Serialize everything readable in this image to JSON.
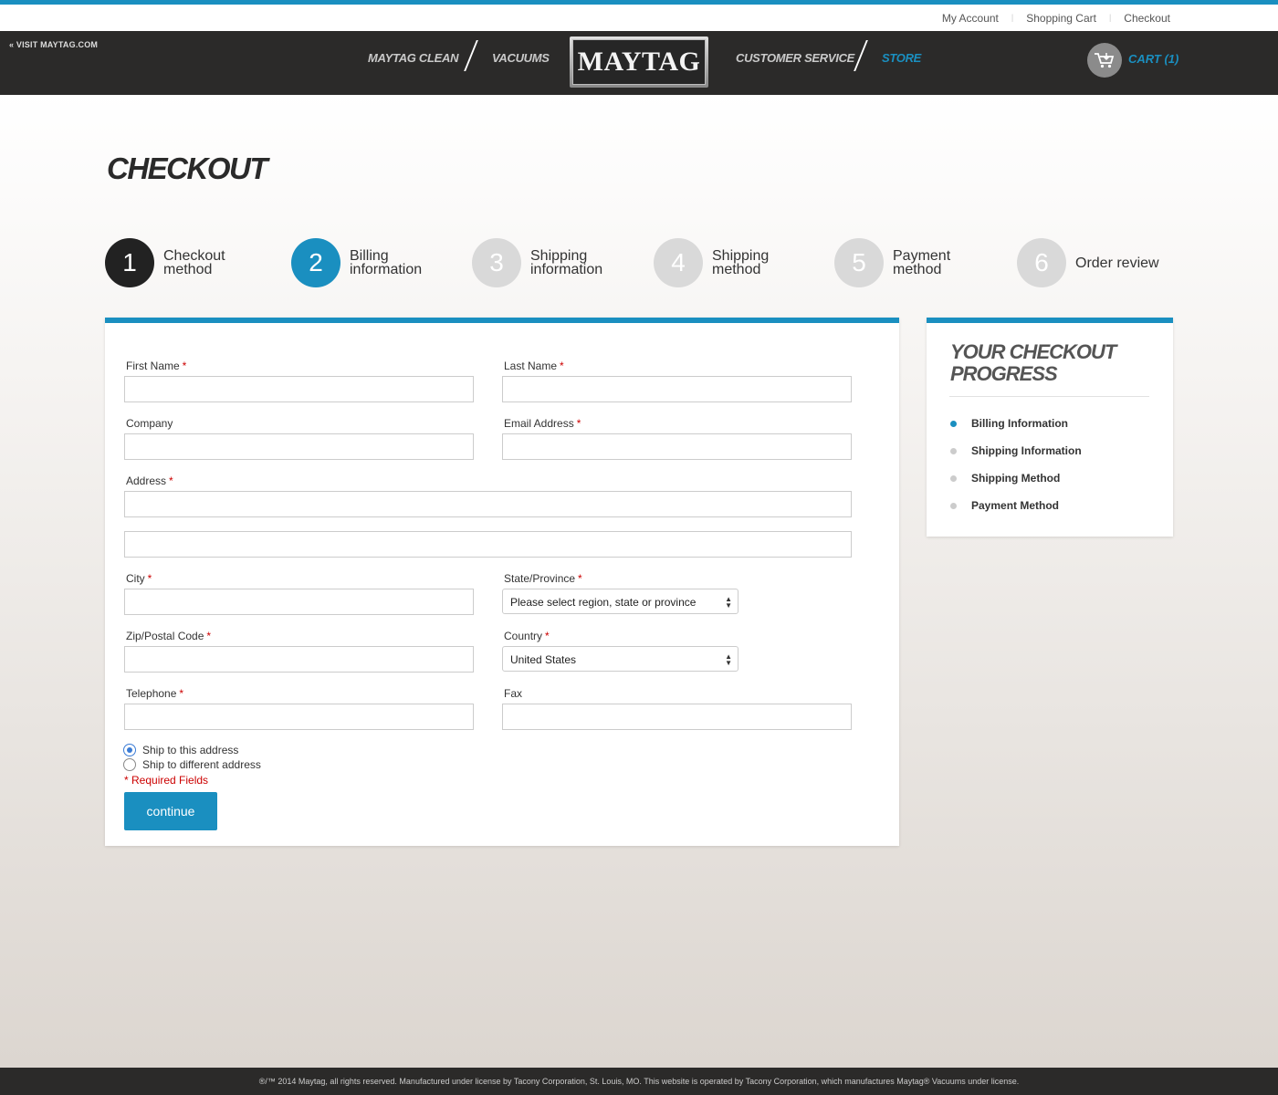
{
  "utility_links": [
    "My Account",
    "Shopping Cart",
    "Checkout"
  ],
  "nav": {
    "visit": "« VISIT MAYTAG.COM",
    "items": [
      "MAYTAG CLEAN",
      "VACUUMS",
      "CUSTOMER SERVICE",
      "STORE"
    ],
    "logo": "MAYTAG",
    "cart": "CART (1)"
  },
  "page_title": "CHECKOUT",
  "steps": [
    {
      "num": "1",
      "label": "Checkout method",
      "state": "done"
    },
    {
      "num": "2",
      "label": "Billing information",
      "state": "active"
    },
    {
      "num": "3",
      "label": "Shipping information",
      "state": "pending"
    },
    {
      "num": "4",
      "label": "Shipping method",
      "state": "pending"
    },
    {
      "num": "5",
      "label": "Payment method",
      "state": "pending"
    },
    {
      "num": "6",
      "label": "Order review",
      "state": "pending"
    }
  ],
  "form": {
    "first_name": "First Name",
    "last_name": "Last Name",
    "company": "Company",
    "email": "Email Address",
    "address": "Address",
    "city": "City",
    "state": "State/Province",
    "state_value": "Please select region, state or province",
    "zip": "Zip/Postal Code",
    "country": "Country",
    "country_value": "United States",
    "telephone": "Telephone",
    "fax": "Fax",
    "required_mark": "*",
    "ship_same": "Ship to this address",
    "ship_diff": "Ship to different address",
    "required_note": "* Required Fields",
    "continue": "continue"
  },
  "progress": {
    "title": "YOUR CHECKOUT PROGRESS",
    "items": [
      "Billing Information",
      "Shipping Information",
      "Shipping Method",
      "Payment Method"
    ]
  },
  "footer": "®/™ 2014 Maytag, all rights reserved. Manufactured under license by Tacony Corporation, St. Louis, MO. This website is operated by Tacony Corporation, which manufactures Maytag® Vacuums under license.",
  "colors": {
    "accent": "#1a8fc0",
    "dark": "#2b2a29",
    "required": "#cc0000"
  }
}
